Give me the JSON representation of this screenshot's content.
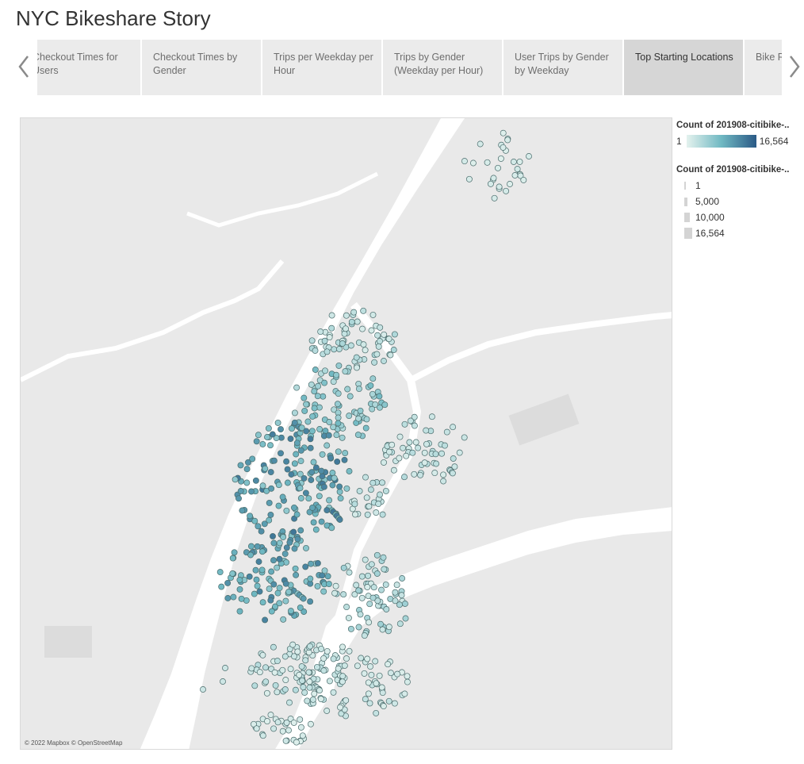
{
  "story_title": "NYC Bikeshare Story",
  "tabs": [
    {
      "label": "Checkout Times for Users"
    },
    {
      "label": "Checkout Times by Gender"
    },
    {
      "label": "Trips per Weekday per Hour"
    },
    {
      "label": "Trips by Gender (Weekday per Hour)"
    },
    {
      "label": "User Trips by Gender by Weekday"
    },
    {
      "label": "Top Starting Locations"
    },
    {
      "label": "Bike R"
    }
  ],
  "active_tab_index": 5,
  "nav": {
    "prev_icon": "chevron-left-icon",
    "next_icon": "chevron-right-icon"
  },
  "map": {
    "attribution": "© 2022 Mapbox © OpenStreetMap",
    "land_color": "#e9e9e9",
    "water_color": "#ffffff"
  },
  "legend": {
    "color_title": "Count of 201908-citibike-..",
    "color_min": "1",
    "color_max": "16,564",
    "color_stops": [
      "#e4f2ee",
      "#6fb8c2",
      "#2b5a86"
    ],
    "size_title": "Count of 201908-citibike-..",
    "size_items": [
      {
        "label": "1",
        "level": 0.05
      },
      {
        "label": "5,000",
        "level": 0.3
      },
      {
        "label": "10,000",
        "level": 0.6
      },
      {
        "label": "16,564",
        "level": 1.0
      }
    ]
  }
}
